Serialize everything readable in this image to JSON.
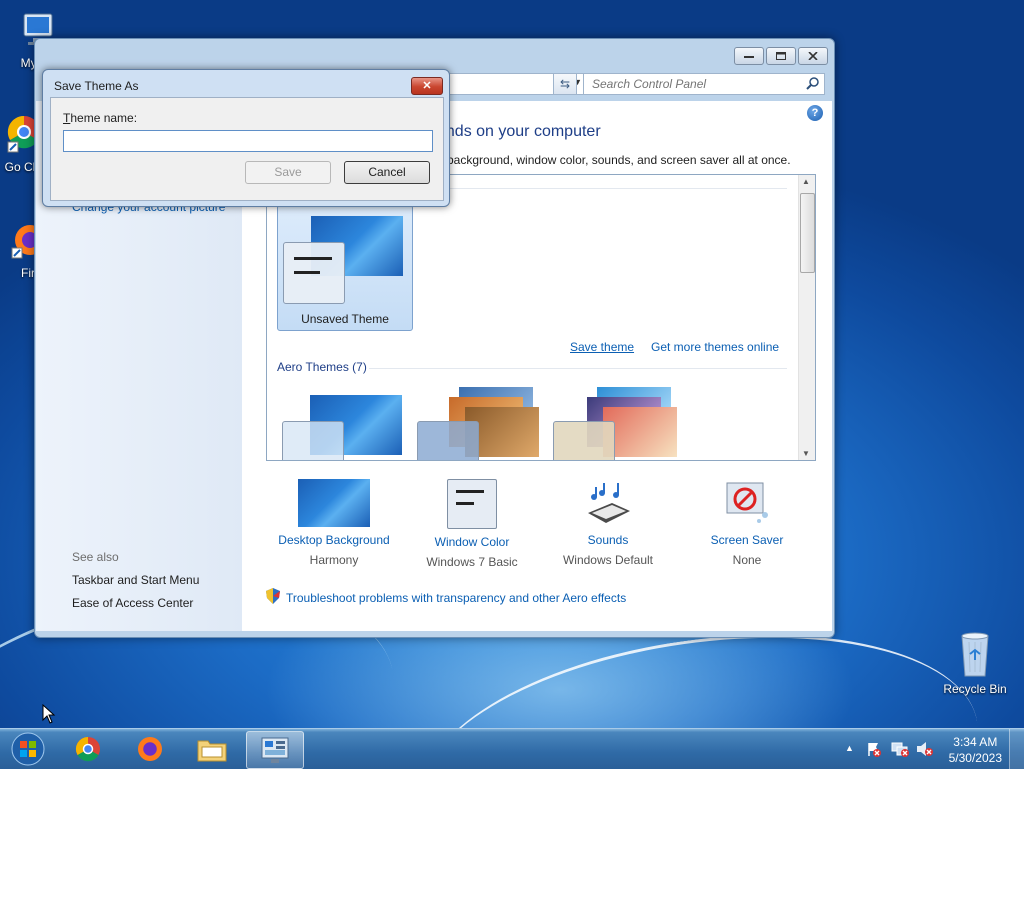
{
  "desktop": {
    "icons": [
      {
        "label": "My Co"
      },
      {
        "label": "Go Chr"
      },
      {
        "label": "Fir"
      },
      {
        "label": "Recycle Bin"
      }
    ]
  },
  "window": {
    "search_placeholder": "Search Control Panel",
    "help_glyph": "?",
    "heading": "unds on your computer",
    "subtitle": "p background, window color, sounds, and screen saver all at once.",
    "sidebar": {
      "partial_link": "Change your account picture",
      "see_also_label": "See also",
      "links": [
        "Taskbar and Start Menu",
        "Ease of Access Center"
      ]
    },
    "my_themes": {
      "tile_label": "Unsaved Theme",
      "save_theme_link": "Save theme",
      "get_more_link": "Get more themes online"
    },
    "aero_section_label": "Aero Themes (7)",
    "bottom_items": [
      {
        "label": "Desktop Background",
        "sub": "Harmony"
      },
      {
        "label": "Window Color",
        "sub": "Windows 7 Basic"
      },
      {
        "label": "Sounds",
        "sub": "Windows Default"
      },
      {
        "label": "Screen Saver",
        "sub": "None"
      }
    ],
    "troubleshoot_link": "Troubleshoot problems with transparency and other Aero effects"
  },
  "dialog": {
    "title": "Save Theme As",
    "field_label_accel": "T",
    "field_label_rest": "heme name:",
    "field_value": "",
    "save_label": "Save",
    "cancel_label": "Cancel",
    "close_glyph": "✕"
  },
  "taskbar": {
    "time": "3:34 AM",
    "date": "5/30/2023"
  }
}
